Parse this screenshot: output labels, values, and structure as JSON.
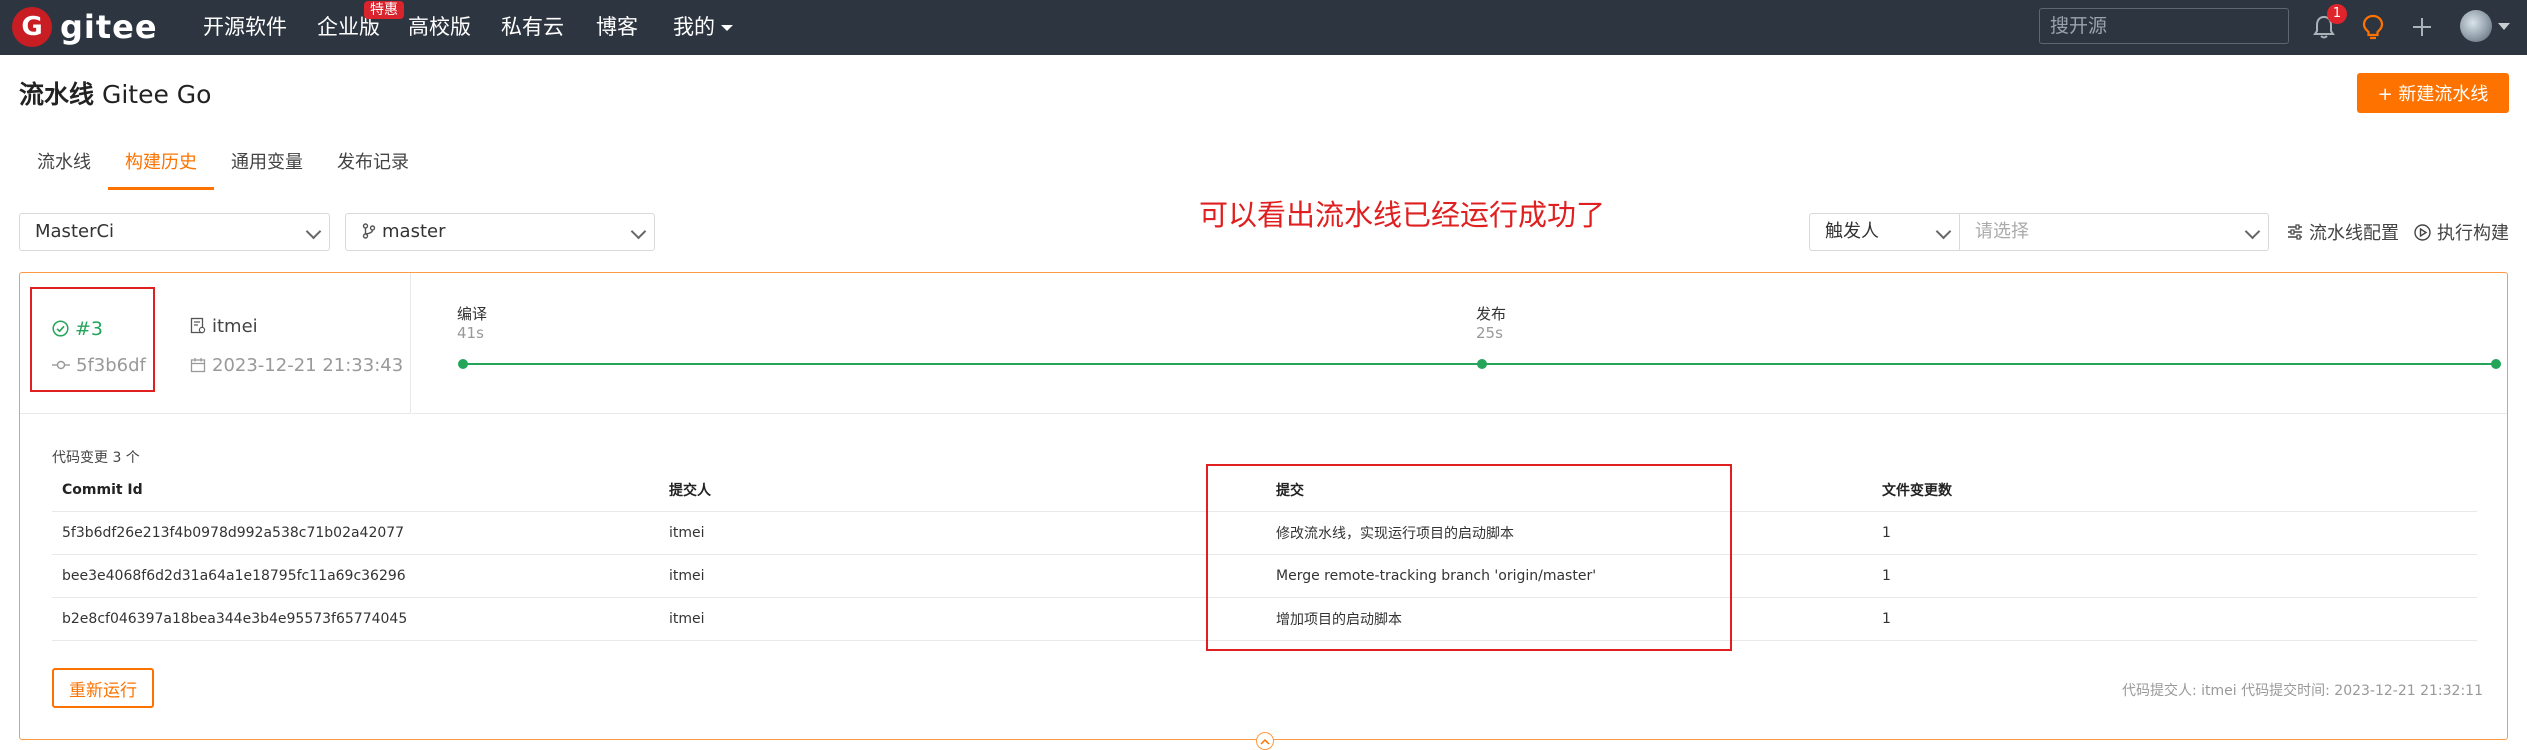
{
  "topnav": {
    "logo_text": "gitee",
    "logo_mark": "G",
    "links": [
      "开源软件",
      "企业版",
      "高校版",
      "私有云",
      "博客",
      "我的"
    ],
    "special_badge": "特惠",
    "search_placeholder": "搜开源",
    "notification_count": "1",
    "colors": {
      "background": "#2d3540",
      "brand": "#c71d23"
    }
  },
  "header": {
    "title_bold": "流水线",
    "title_rest": " Gitee Go",
    "new_button": "+ 新建流水线"
  },
  "tabs": [
    "流水线",
    "构建历史",
    "通用变量",
    "发布记录"
  ],
  "active_tab": "构建历史",
  "filters": {
    "pipeline_select": "MasterCi",
    "branch_select": "master",
    "trigger_select": "触发人",
    "trigger_placeholder": "请选择",
    "pipeline_config": "流水线配置",
    "run_build": "执行构建"
  },
  "annotation_text": "可以看出流水线已经运行成功了",
  "build": {
    "number": "#3",
    "commit_short": "5f3b6df",
    "trigger_user": "itmei",
    "trigger_time": "2023-12-21 21:33:43",
    "status": "success",
    "stages": [
      {
        "name": "编译",
        "duration": "41s"
      },
      {
        "name": "发布",
        "duration": "25s"
      }
    ],
    "changes_title": "代码变更 3 个",
    "table": {
      "headers": [
        "Commit Id",
        "提交人",
        "提交",
        "文件变更数"
      ],
      "rows": [
        [
          "5f3b6df26e213f4b0978d992a538c71b02a42077",
          "itmei",
          "修改流水线，实现运行项目的启动脚本",
          "1"
        ],
        [
          "bee3e4068f6d2d31a64a1e18795fc11a69c36296",
          "itmei",
          "Merge remote-tracking branch 'origin/master'",
          "1"
        ],
        [
          "b2e8cf046397a18bea344e3b4e95573f65774045",
          "itmei",
          "增加项目的启动脚本",
          "1"
        ]
      ]
    },
    "rerun_button": "重新运行",
    "committer_info": "代码提交人: itmei  代码提交时间: 2023-12-21 21:32:11"
  },
  "colors": {
    "accent": "#fe7300",
    "success": "#23a55a",
    "annotation": "#e02020"
  }
}
